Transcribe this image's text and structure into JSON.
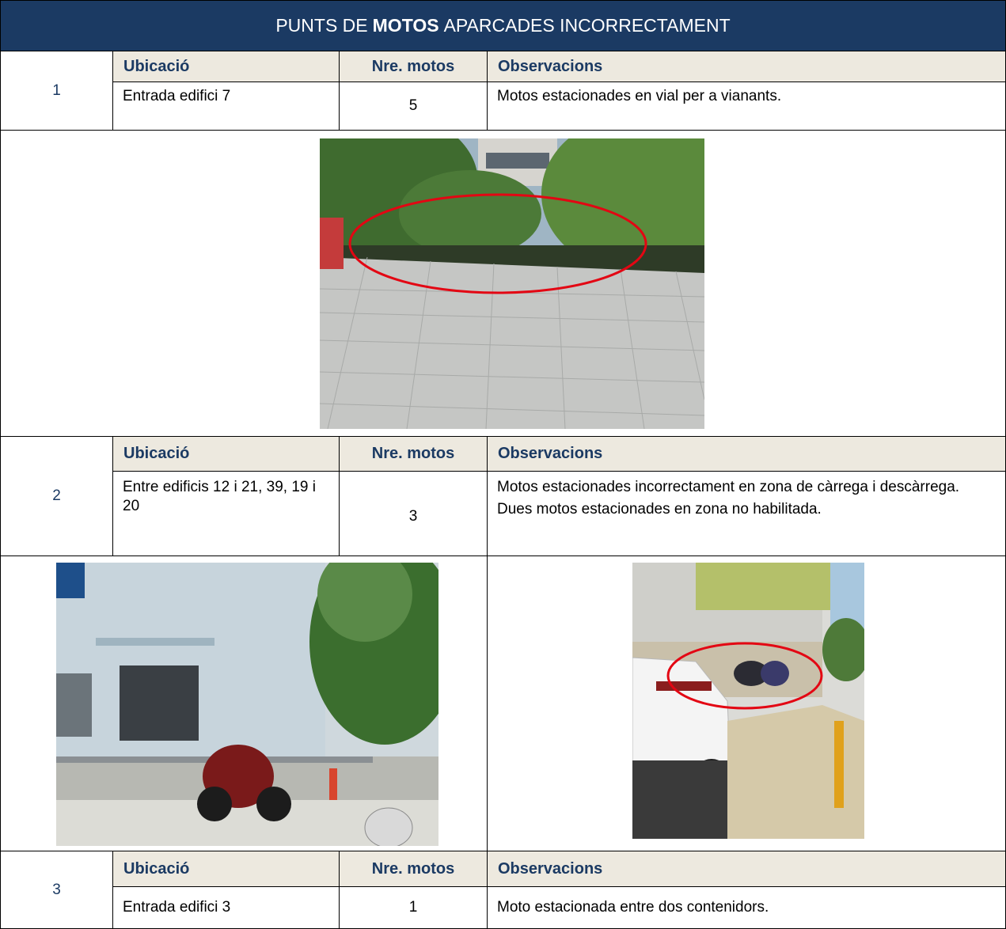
{
  "title": {
    "pre": "PUNTS DE",
    "bold": "MOTOS",
    "post": "APARCADES INCORRECTAMENT"
  },
  "headers": {
    "location": "Ubicació",
    "count": "Nre. motos",
    "notes": "Observacions"
  },
  "entries": [
    {
      "number": "1",
      "location": "Entrada edifici 7",
      "count": "5",
      "notes": [
        "Motos estacionades en vial per a vianants."
      ]
    },
    {
      "number": "2",
      "location": "Entre edificis 12 i 21, 39, 19 i 20",
      "count": "3",
      "notes": [
        "Motos estacionades incorrectament en zona de càrrega i descàrrega.",
        "Dues motos estacionades en zona no habilitada."
      ]
    },
    {
      "number": "3",
      "location": "Entrada edifici 3",
      "count": "1",
      "notes": [
        "Moto estacionada entre dos contenidors."
      ]
    }
  ],
  "colors": {
    "title_bg": "#1b3a63",
    "header_bg": "#ede9df",
    "header_text": "#1b3a63",
    "highlight": "#e30613"
  }
}
